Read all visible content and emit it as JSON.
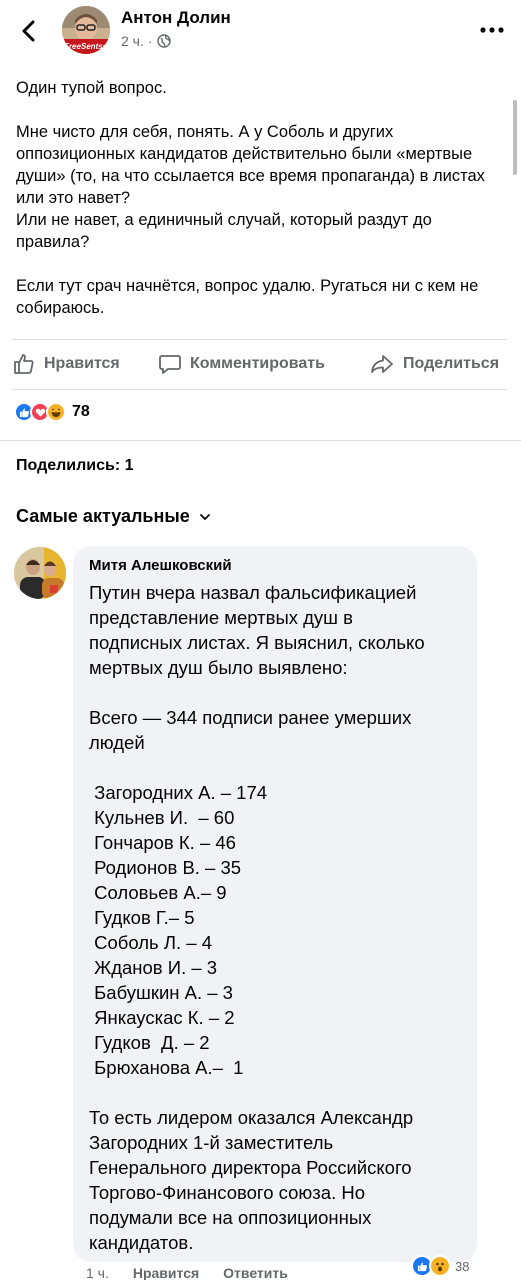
{
  "post": {
    "author": "Антон Долин",
    "time": "2 ч.",
    "dot": "·",
    "avatar_caption": "FreeSentsov",
    "paragraphs": [
      "Один тупой вопрос.",
      "",
      "Мне чисто для себя, понять. А у Соболь и других оппозиционных кандидатов действительно были «мертвые души» (то, на что ссылается все время пропаганда) в листах или это навет?",
      "Или не навет, а единичный случай, который раздут до правила?",
      "",
      "Если тут срач начнётся, вопрос удалю. Ругаться ни с кем не собираюсь."
    ]
  },
  "actions": {
    "like": "Нравится",
    "comment": "Комментировать",
    "share": "Поделиться"
  },
  "reactions": {
    "count": "78",
    "icons": [
      "like-icon",
      "love-icon",
      "haha-icon"
    ]
  },
  "shares": "Поделились: 1",
  "sort_label": "Самые актуальные",
  "comment": {
    "author": "Митя Алешковский",
    "lines": [
      "Путин вчера назвал фальсификацией",
      "представление мертвых душ в",
      "подписных листах. Я выяснил, сколько",
      "мертвых душ было выявлено:",
      "",
      "Всего — 344 подписи ранее умерших",
      "людей",
      "",
      " Загородних А. – 174",
      " Кульнев И.  – 60",
      " Гончаров К. – 46",
      " Родионов В. – 35",
      " Соловьев А.– 9",
      " Гудков Г.– 5",
      " Соболь Л. – 4",
      " Жданов И. – 3",
      " Бабушкин А. – 3",
      " Янкаускас К. – 2",
      " Гудков  Д. – 2",
      " Брюханова А.–  1",
      "",
      "То есть лидером оказался Александр",
      "Загородних 1-й заместитель",
      "Генерального директора Российского",
      "Торгово-Финансового союза. Но",
      "подумали все на оппозиционных",
      "кандидатов."
    ],
    "time": "1 ч.",
    "like": "Нравится",
    "reply": "Ответить",
    "reaction_count": "38",
    "reaction_icons": [
      "like-icon",
      "wow-icon"
    ]
  },
  "colors": {
    "like_blue": "#1877f2",
    "love_red": "#f33e58",
    "haha_yellow": "#f7b125",
    "secondary_text": "#65676b",
    "bubble_bg": "#f0f2f5"
  }
}
